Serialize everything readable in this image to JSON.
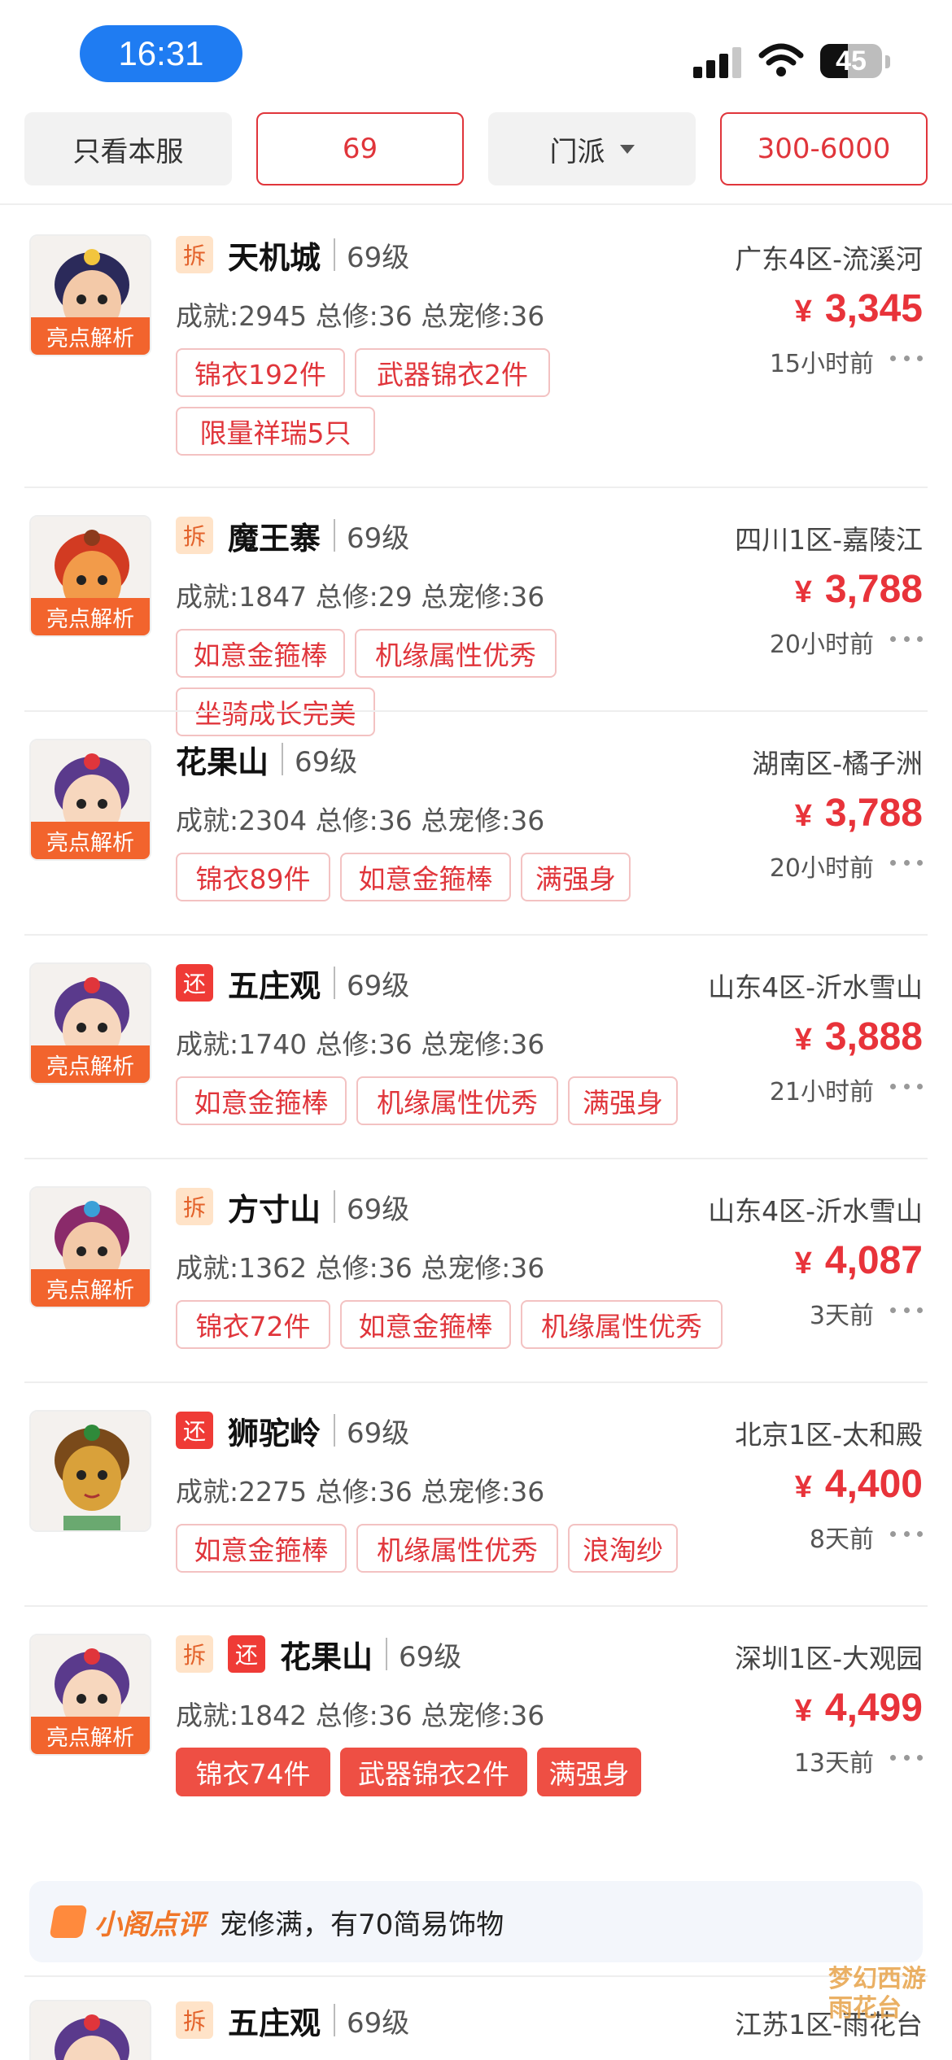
{
  "status_bar": {
    "time": "16:31",
    "battery": "45",
    "battery_level": 0.45
  },
  "filters": [
    {
      "label": "只看本服"
    },
    {
      "label": "69"
    },
    {
      "label": "门派"
    },
    {
      "label": "300-6000"
    }
  ],
  "listings": [
    {
      "highlight": "亮点解析",
      "badges": [
        "拆"
      ],
      "sect": "天机城",
      "level": "69级",
      "server": "广东4区-流溪河",
      "stats": "成就:2945 总修:36 总宠修:36",
      "currency": "¥",
      "price": "3,345",
      "time_ago": "15小时前",
      "tags": [
        "锦衣192件",
        "武器锦衣2件",
        "限量祥瑞5只"
      ]
    },
    {
      "highlight": "亮点解析",
      "badges": [
        "拆"
      ],
      "sect": "魔王寨",
      "level": "69级",
      "server": "四川1区-嘉陵江",
      "stats": "成就:1847 总修:29 总宠修:36",
      "currency": "¥",
      "price": "3,788",
      "time_ago": "20小时前",
      "tags": [
        "如意金箍棒",
        "机缘属性优秀",
        "坐骑成长完美"
      ]
    },
    {
      "highlight": "亮点解析",
      "badges": [],
      "sect": "花果山",
      "level": "69级",
      "server": "湖南区-橘子洲",
      "stats": "成就:2304 总修:36 总宠修:36",
      "currency": "¥",
      "price": "3,788",
      "time_ago": "20小时前",
      "tags": [
        "锦衣89件",
        "如意金箍棒",
        "满强身"
      ]
    },
    {
      "highlight": "亮点解析",
      "badges": [
        "还"
      ],
      "sect": "五庄观",
      "level": "69级",
      "server": "山东4区-沂水雪山",
      "stats": "成就:1740 总修:36 总宠修:36",
      "currency": "¥",
      "price": "3,888",
      "time_ago": "21小时前",
      "tags": [
        "如意金箍棒",
        "机缘属性优秀",
        "满强身"
      ]
    },
    {
      "highlight": "亮点解析",
      "badges": [
        "拆"
      ],
      "sect": "方寸山",
      "level": "69级",
      "server": "山东4区-沂水雪山",
      "stats": "成就:1362 总修:36 总宠修:36",
      "currency": "¥",
      "price": "4,087",
      "time_ago": "3天前",
      "tags": [
        "锦衣72件",
        "如意金箍棒",
        "机缘属性优秀"
      ]
    },
    {
      "highlight": "",
      "badges": [
        "还"
      ],
      "sect": "狮驼岭",
      "level": "69级",
      "server": "北京1区-太和殿",
      "stats": "成就:2275 总修:36 总宠修:36",
      "currency": "¥",
      "price": "4,400",
      "time_ago": "8天前",
      "tags": [
        "如意金箍棒",
        "机缘属性优秀",
        "浪淘纱"
      ]
    },
    {
      "highlight": "亮点解析",
      "badges": [
        "拆",
        "还"
      ],
      "sect": "花果山",
      "level": "69级",
      "server": "深圳1区-大观园",
      "stats": "成就:1842 总修:36 总宠修:36",
      "currency": "¥",
      "price": "4,499",
      "time_ago": "13天前",
      "tags": [
        "锦衣74件",
        "武器锦衣2件",
        "满强身"
      ]
    },
    {
      "highlight": "",
      "badges": [
        "拆"
      ],
      "sect": "五庄观",
      "level": "69级",
      "server": "江苏1区-雨花台",
      "stats": "",
      "currency": "",
      "price": "",
      "time_ago": "",
      "tags": []
    }
  ],
  "comment": {
    "title": "小阁点评",
    "text": "宠修满，有70简易饰物"
  },
  "colors": {
    "accent_red": "#e8333a",
    "highlight_orange": "#f2642d",
    "time_pill_blue": "#1f7cf2"
  }
}
